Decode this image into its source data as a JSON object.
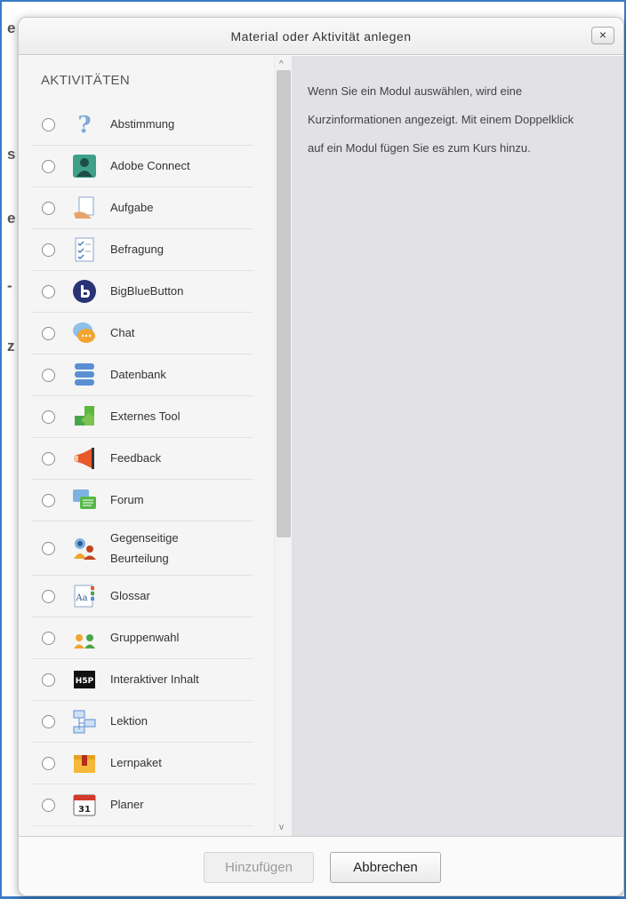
{
  "background_fragments": [
    "e",
    "s",
    "e",
    "-",
    "z"
  ],
  "dialog": {
    "title": "Material oder Aktivität anlegen",
    "close_label": "×"
  },
  "list": {
    "heading": "AKTIVITÄTEN",
    "items": [
      {
        "label": "Abstimmung",
        "icon": "question-icon"
      },
      {
        "label": "Adobe Connect",
        "icon": "adobe-connect-icon"
      },
      {
        "label": "Aufgabe",
        "icon": "assignment-icon"
      },
      {
        "label": "Befragung",
        "icon": "survey-icon"
      },
      {
        "label": "BigBlueButton",
        "icon": "bigbluebutton-icon"
      },
      {
        "label": "Chat",
        "icon": "chat-icon"
      },
      {
        "label": "Datenbank",
        "icon": "database-icon"
      },
      {
        "label": "Externes Tool",
        "icon": "puzzle-icon"
      },
      {
        "label": "Feedback",
        "icon": "megaphone-icon"
      },
      {
        "label": "Forum",
        "icon": "forum-icon"
      },
      {
        "label": "Gegenseitige Beurteilung",
        "label_line1": "Gegenseitige",
        "label_line2": "Beurteilung",
        "icon": "peer-review-icon"
      },
      {
        "label": "Glossar",
        "icon": "glossary-icon"
      },
      {
        "label": "Gruppenwahl",
        "icon": "group-choice-icon"
      },
      {
        "label": "Interaktiver Inhalt",
        "icon": "h5p-icon",
        "icon_text": "H5P"
      },
      {
        "label": "Lektion",
        "icon": "lesson-icon"
      },
      {
        "label": "Lernpaket",
        "icon": "package-icon"
      },
      {
        "label": "Planer",
        "icon": "calendar-icon",
        "icon_text": "31"
      }
    ]
  },
  "info": {
    "text": "Wenn Sie ein Modul auswählen, wird eine Kurzinformationen angezeigt. Mit einem Doppelklick auf ein Modul fügen Sie es zum Kurs hinzu."
  },
  "footer": {
    "add_label": "Hinzufügen",
    "cancel_label": "Abbrechen"
  },
  "scrollbar": {
    "up_arrow": "^",
    "down_arrow": "v"
  }
}
